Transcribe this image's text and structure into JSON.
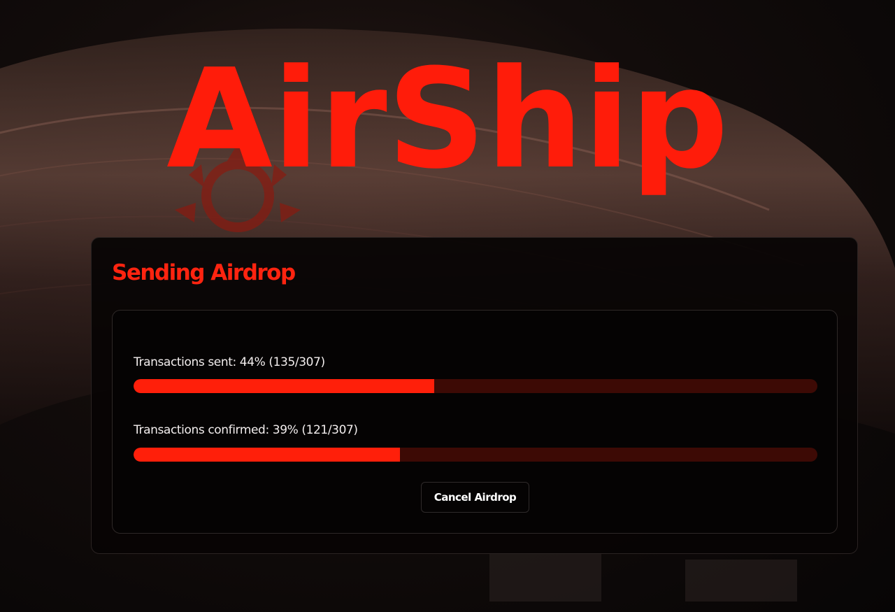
{
  "brand": {
    "title": "AirShip"
  },
  "panel": {
    "title": "Sending Airdrop",
    "progress": [
      {
        "label": "Transactions sent: 44% (135/307)",
        "fraction": 0.44
      },
      {
        "label": "Transactions confirmed: 39% (121/307)",
        "fraction": 0.39
      }
    ],
    "cancel_label": "Cancel Airdrop"
  },
  "colors": {
    "accent": "#ff1f0a",
    "track": "#3d0a05",
    "panel_background": "#080404"
  },
  "background": {
    "image": "airship-illustration"
  }
}
